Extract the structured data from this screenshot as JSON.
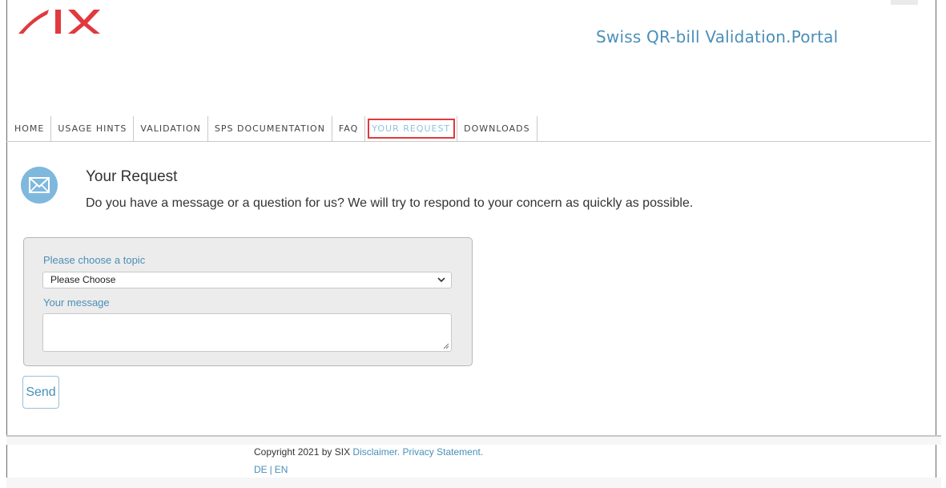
{
  "header": {
    "logo_text": "SIX",
    "portal_title": "Swiss QR-bill Validation.Portal"
  },
  "nav": {
    "items": [
      {
        "label": "HOME",
        "active": false
      },
      {
        "label": "USAGE HINTS",
        "active": false
      },
      {
        "label": "VALIDATION",
        "active": false
      },
      {
        "label": "SPS DOCUMENTATION",
        "active": false
      },
      {
        "label": "FAQ",
        "active": false
      },
      {
        "label": "YOUR REQUEST",
        "active": true
      },
      {
        "label": "DOWNLOADS",
        "active": false
      }
    ]
  },
  "request": {
    "icon": "mail-icon",
    "title": "Your Request",
    "description": "Do you have a message or a question for us? We will try to respond to your concern as quickly as possible."
  },
  "form": {
    "topic_label": "Please choose a topic",
    "topic_value": "Please Choose",
    "message_label": "Your message",
    "message_value": "",
    "send_label": "Send"
  },
  "footer": {
    "copyright": "Copyright 2021 by SIX",
    "disclaimer": "Disclaimer.",
    "privacy": "Privacy Statement.",
    "lang_de": "DE",
    "lang_sep": "|",
    "lang_en": "EN"
  },
  "colors": {
    "accent": "#4a8fb8",
    "logo_red": "#e03a3e",
    "highlight_border": "#e03a3e",
    "active_tab_text": "#8fc3e2"
  }
}
